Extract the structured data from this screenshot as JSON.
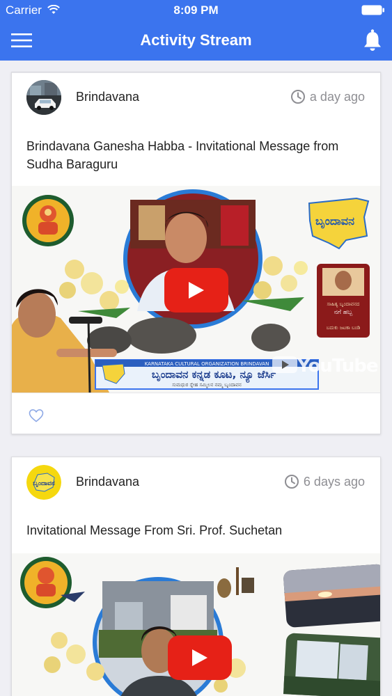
{
  "status_bar": {
    "carrier": "Carrier",
    "time": "8:09 PM"
  },
  "nav": {
    "title": "Activity Stream",
    "menu_icon": "hamburger-menu-icon",
    "right_icon": "bell-icon"
  },
  "colors": {
    "primary": "#3b74ee",
    "youtube_red": "#e62117",
    "meta_gray": "#8e8e93"
  },
  "feed": [
    {
      "author": "Brindavana",
      "time": "a day ago",
      "title": "Brindavana Ganesha Habba - Invitational Message from Sudha Baraguru",
      "media": {
        "banner_text_1": "KARNATAKA CULTURAL ORGANIZATION BRINDAVAN",
        "banner_text_2": "ಬೃಂದಾವನ ಕನ್ನಡ ಕೂಟ, ನ್ಯೂ ಜೆರ್ಸಿ",
        "banner_text_3": "ಸುಮಧುರ ಸ್ನೇಹ ಸಮ್ಮಿಲನ  ನಮ್ಮ ಬೃಂದಾವನ",
        "logo_text": "ಬೃಂದಾವನ",
        "side_card_text_1": "ಸಾಹಿತ್ಯ ಬೃಂದಾವನದ",
        "side_card_text_2": "ನಗೆ ಹಬ್ಬ",
        "side_card_text_3": "ಬದುಕು ಜಟಕಾ ಬಂಡಿ",
        "watermark": "YouTube"
      },
      "liked": false
    },
    {
      "author": "Brindavana",
      "time": "6 days ago",
      "title": "Invitational Message From Sri. Prof. Suchetan",
      "media": {
        "logo_text": "ಬೃಂದಾವನ"
      }
    }
  ]
}
